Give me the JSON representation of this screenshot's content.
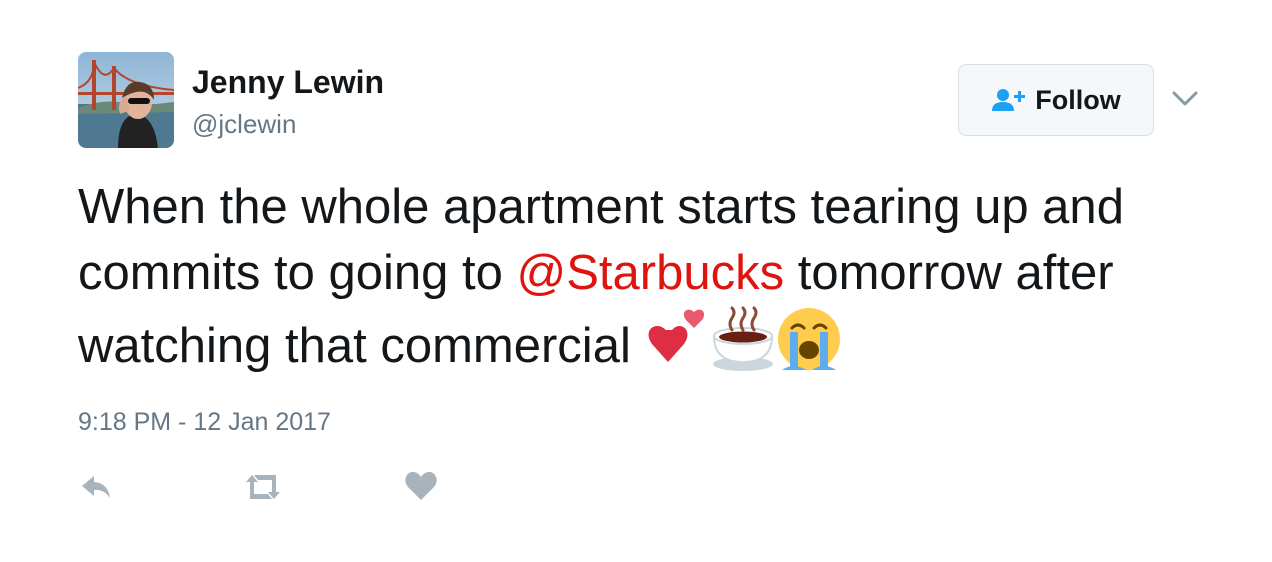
{
  "tweet": {
    "author": {
      "name": "Jenny Lewin",
      "handle": "@jclewin"
    },
    "follow_button": {
      "label": "Follow",
      "icon": "add-user-icon"
    },
    "menu_icon": "chevron-down-icon",
    "text": {
      "part1": "When the whole apartment starts tearing up and commits to going to ",
      "mention": "@Starbucks",
      "part2": " tomorrow after watching that commercial "
    },
    "emojis": [
      "two-hearts-emoji",
      "hot-beverage-emoji",
      "loudly-crying-face-emoji"
    ],
    "timestamp": "9:18 PM - 12 Jan 2017",
    "actions": [
      "reply-icon",
      "retweet-icon",
      "like-icon"
    ]
  },
  "colors": {
    "mention": "#e0140f",
    "follow_icon": "#1da1f2",
    "secondary_text": "#657786",
    "action_icon": "#a7b4be"
  }
}
